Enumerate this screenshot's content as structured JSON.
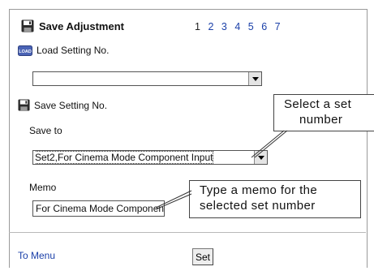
{
  "header": {
    "title": "Save Adjustment",
    "pages": [
      "1",
      "2",
      "3",
      "4",
      "5",
      "6",
      "7"
    ],
    "current_page": "1"
  },
  "load": {
    "icon_text": "LOAD",
    "label": "Load Setting No.",
    "selected": ""
  },
  "save": {
    "label": "Save Setting No.",
    "save_to_label": "Save to",
    "selected": "Set2,For Cinema Mode Component Input"
  },
  "memo": {
    "label": "Memo",
    "value": "For Cinema Mode Component"
  },
  "callouts": {
    "select_set_line1": "Select a set",
    "select_set_line2": "number",
    "type_memo_line1": "Type a memo for the",
    "type_memo_line2": "selected set number"
  },
  "footer": {
    "menu_link": "To Menu",
    "set_button": "Set"
  },
  "colors": {
    "link": "#1a3fa8",
    "border": "#9a9a9a"
  }
}
